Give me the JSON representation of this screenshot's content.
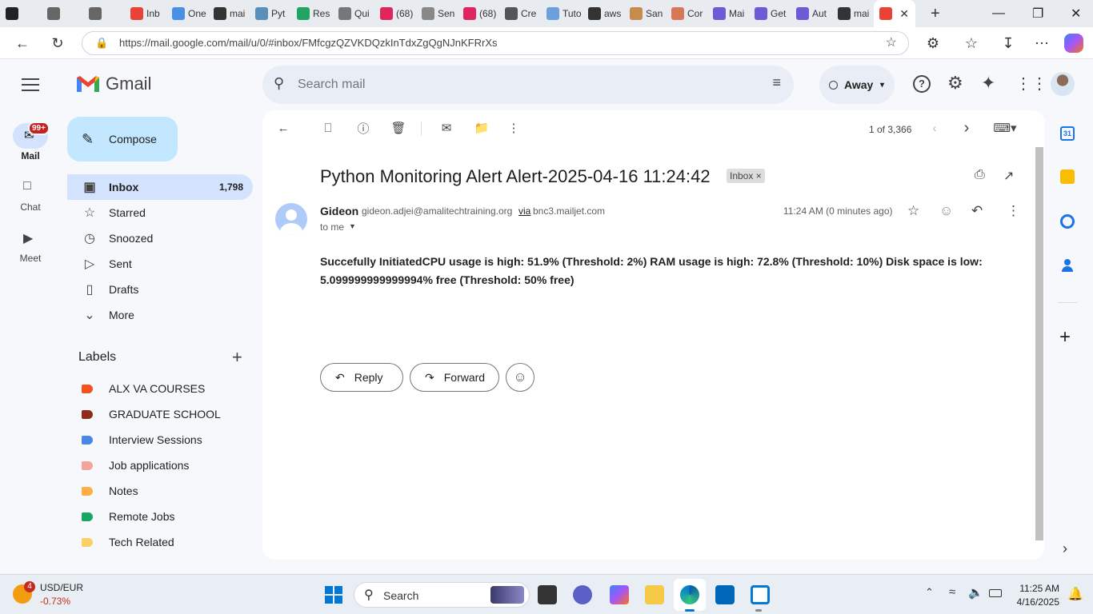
{
  "browser": {
    "tabs": [
      {
        "label": "",
        "color": "#222"
      },
      {
        "label": "",
        "color": "#666"
      },
      {
        "label": "",
        "color": "#666"
      },
      {
        "label": "Inb",
        "color": "#ea4335"
      },
      {
        "label": "One",
        "color": "#4a8fe7"
      },
      {
        "label": "mai",
        "color": "#333"
      },
      {
        "label": "Pyt",
        "color": "#5b8fb9"
      },
      {
        "label": "Res",
        "color": "#21a366"
      },
      {
        "label": "Qui",
        "color": "#777"
      },
      {
        "label": "(68)",
        "color": "#e0245e"
      },
      {
        "label": "Sen",
        "color": "#888"
      },
      {
        "label": "(68)",
        "color": "#e0245e"
      },
      {
        "label": "Cre",
        "color": "#555"
      },
      {
        "label": "Tuto",
        "color": "#6ca0dc"
      },
      {
        "label": "aws",
        "color": "#333"
      },
      {
        "label": "San",
        "color": "#c98b4c"
      },
      {
        "label": "Cor",
        "color": "#d97757"
      },
      {
        "label": "Mai",
        "color": "#6b5bd6"
      },
      {
        "label": "Get",
        "color": "#6b5bd6"
      },
      {
        "label": "Aut",
        "color": "#6b5bd6"
      },
      {
        "label": "mai",
        "color": "#333"
      },
      {
        "label": "",
        "color": "#ea4335"
      }
    ],
    "url": "https://mail.google.com/mail/u/0/#inbox/FMfcgzQZVKDQzkInTdxZgQgNJnKFRrXs"
  },
  "gmail": {
    "logo_text": "Gmail",
    "search_placeholder": "Search mail",
    "status": "Away",
    "compose_label": "Compose",
    "rail": {
      "mail_label": "Mail",
      "mail_badge": "99+",
      "chat_label": "Chat",
      "meet_label": "Meet"
    },
    "nav": [
      {
        "label": "Inbox",
        "count": "1,798",
        "icon": "inbox-icon"
      },
      {
        "label": "Starred",
        "count": "",
        "icon": "star-icon"
      },
      {
        "label": "Snoozed",
        "count": "",
        "icon": "clock-icon"
      },
      {
        "label": "Sent",
        "count": "",
        "icon": "send-icon"
      },
      {
        "label": "Drafts",
        "count": "",
        "icon": "draft-icon"
      },
      {
        "label": "More",
        "count": "",
        "icon": "chevron-down-icon"
      }
    ],
    "labels_title": "Labels",
    "labels": [
      {
        "label": "ALX VA COURSES",
        "color": "#f4511e"
      },
      {
        "label": "GRADUATE SCHOOL",
        "color": "#8d2c1a"
      },
      {
        "label": "Interview Sessions",
        "color": "#4a86e8"
      },
      {
        "label": "Job applications",
        "color": "#f2a59a"
      },
      {
        "label": "Notes",
        "color": "#ffad47"
      },
      {
        "label": "Remote Jobs",
        "color": "#16a765"
      },
      {
        "label": "Tech Related",
        "color": "#fad165"
      }
    ],
    "pagination": "1 of 3,366",
    "email": {
      "subject": "Python Monitoring Alert Alert-2025-04-16 11:24:42",
      "tag": "Inbox",
      "sender_name": "Gideon",
      "sender_email": "gideon.adjei@amalitechtraining.org",
      "via": "via",
      "via_domain": "bnc3.mailjet.com",
      "to": "to me",
      "time": "11:24 AM (0 minutes ago)",
      "body": "Succefully InitiatedCPU usage is high: 51.9% (Threshold: 2%) RAM usage is high: 72.8% (Threshold: 10%) Disk space is low: 5.099999999999994% free (Threshold: 50% free)"
    },
    "reply_label": "Reply",
    "forward_label": "Forward"
  },
  "taskbar": {
    "weather_badge": "4",
    "currency": "USD/EUR",
    "change": "-0.73%",
    "search_label": "Search",
    "time": "11:25 AM",
    "date": "4/16/2025"
  }
}
